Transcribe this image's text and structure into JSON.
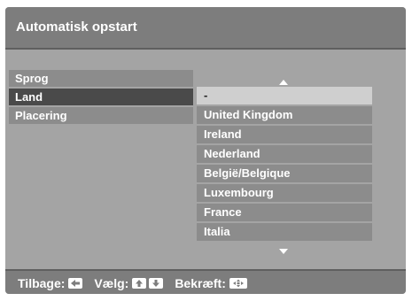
{
  "header": {
    "title": "Automatisk opstart"
  },
  "menu": {
    "items": [
      {
        "label": "Sprog",
        "selected": false
      },
      {
        "label": "Land",
        "selected": true
      },
      {
        "label": "Placering",
        "selected": false
      }
    ]
  },
  "country_list": {
    "scroll_up_icon": "triangle-up",
    "scroll_down_icon": "triangle-down",
    "items": [
      "-",
      "United Kingdom",
      "Ireland",
      "Nederland",
      "België/Belgique",
      "Luxembourg",
      "France",
      "Italia"
    ],
    "selected_index": 0
  },
  "footer": {
    "back_label": "Tilbage:",
    "back_icon": "arrow-left-key",
    "select_label": "Vælg:",
    "select_icons": [
      "arrow-up-key",
      "arrow-down-key"
    ],
    "confirm_label": "Bekræft:",
    "confirm_icon": "center-key"
  }
}
